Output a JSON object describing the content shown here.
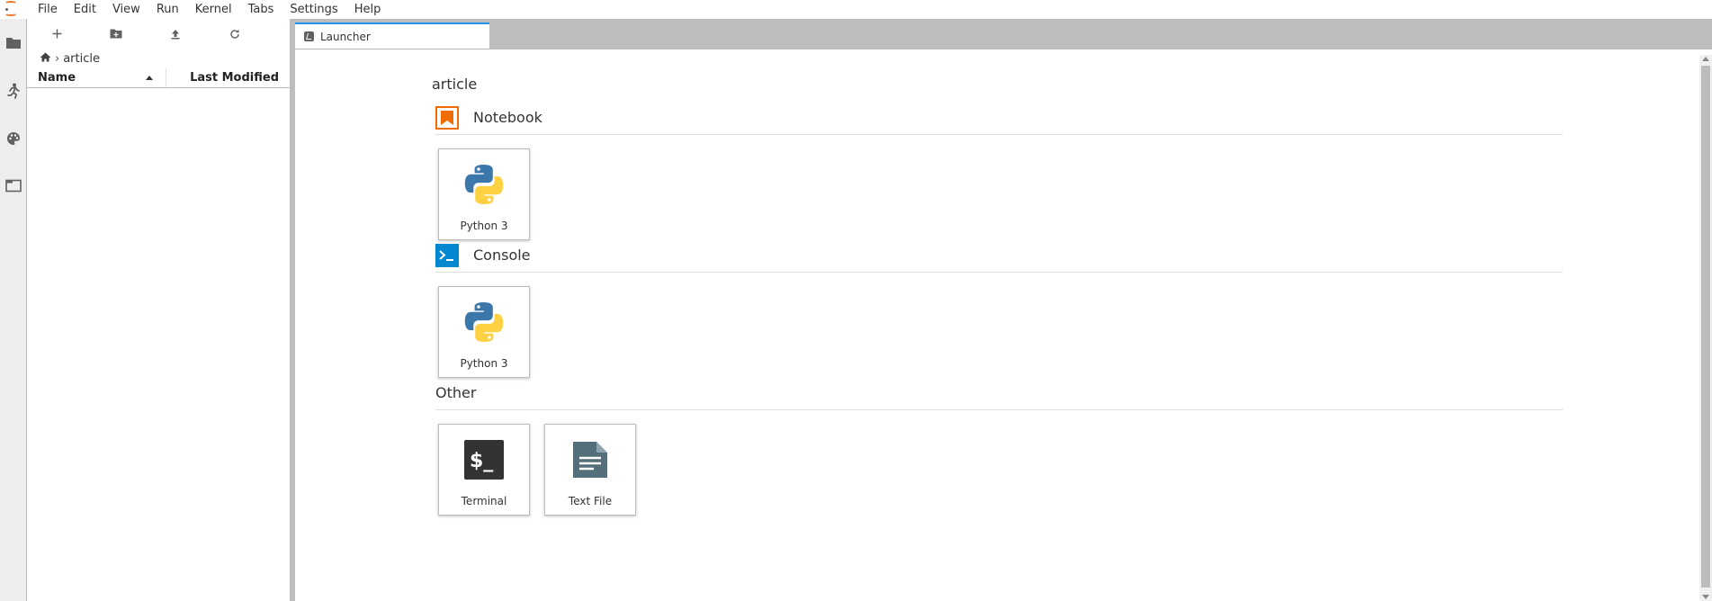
{
  "menubar": {
    "items": [
      "File",
      "Edit",
      "View",
      "Run",
      "Kernel",
      "Tabs",
      "Settings",
      "Help"
    ]
  },
  "activitybar": {
    "icons": [
      "folder-icon",
      "running-icon",
      "palette-icon",
      "tabs-icon"
    ]
  },
  "filebrowser": {
    "breadcrumb": "article",
    "columns": {
      "name": "Name",
      "modified": "Last Modified"
    }
  },
  "tabs": [
    {
      "label": "Launcher"
    }
  ],
  "launcher": {
    "cwd": "article",
    "sections": {
      "notebook": {
        "title": "Notebook",
        "cards": [
          {
            "label": "Python 3"
          }
        ]
      },
      "console": {
        "title": "Console",
        "cards": [
          {
            "label": "Python 3"
          }
        ]
      },
      "other": {
        "title": "Other",
        "cards": [
          {
            "label": "Terminal"
          },
          {
            "label": "Text File"
          }
        ]
      }
    }
  },
  "colors": {
    "accent": "#2196f3",
    "notebook_orange": "#ef6c00",
    "console_blue": "#0288d1",
    "python_blue": "#3c77a9",
    "python_yellow": "#fed142"
  }
}
